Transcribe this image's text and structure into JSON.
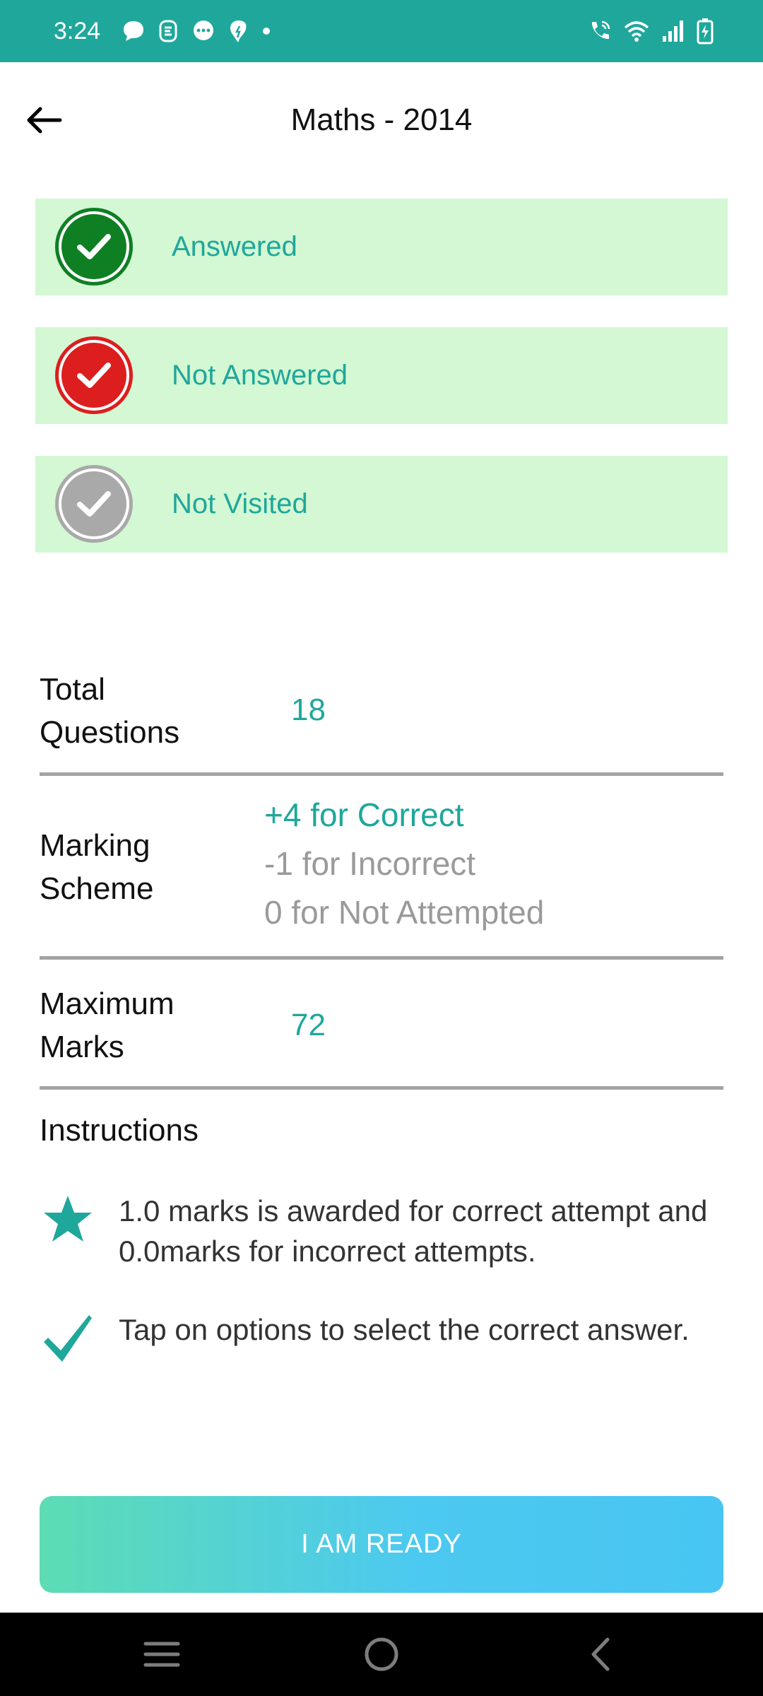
{
  "status_bar": {
    "time": "3:24",
    "background": "#1fa79b",
    "notification_icons": [
      "chat-bubble-icon",
      "notification-app-icon",
      "message-dots-icon",
      "shield-leaf-icon",
      "dot-icon"
    ],
    "system_icons": [
      "wifi-calling-icon",
      "wifi-icon",
      "signal-icon",
      "battery-charging-icon"
    ]
  },
  "header": {
    "title": "Maths - 2014",
    "back_icon": "arrow-left-icon"
  },
  "legend": [
    {
      "label": "Answered",
      "color": "#0f7f24",
      "icon": "check-circle-icon"
    },
    {
      "label": "Not Answered",
      "color": "#dd1e1e",
      "icon": "check-circle-icon"
    },
    {
      "label": "Not Visited",
      "color": "#a9a9a9",
      "icon": "check-circle-icon"
    }
  ],
  "legend_background": "#d3f8d3",
  "info": {
    "total_questions": {
      "label_line1": "Total",
      "label_line2": "Questions",
      "value": "18"
    },
    "marking_scheme": {
      "label_line1": "Marking",
      "label_line2": "Scheme",
      "correct": "+4 for Correct",
      "incorrect": "-1 for Incorrect",
      "not_attempted": "0 for Not Attempted"
    },
    "maximum_marks": {
      "label_line1": "Maximum",
      "label_line2": "Marks",
      "value": "72"
    }
  },
  "instructions": {
    "title": "Instructions",
    "items": [
      {
        "icon": "star-icon",
        "text": "1.0 marks is awarded for correct attempt and 0.0marks for incorrect attempts."
      },
      {
        "icon": "checkmark-icon",
        "text": "Tap on options to select the correct answer."
      }
    ]
  },
  "ready_button": {
    "label": "I AM READY"
  },
  "nav_bar": {
    "icons": [
      "recents-icon",
      "home-icon",
      "back-icon"
    ]
  },
  "accent_color": "#1fa79b"
}
